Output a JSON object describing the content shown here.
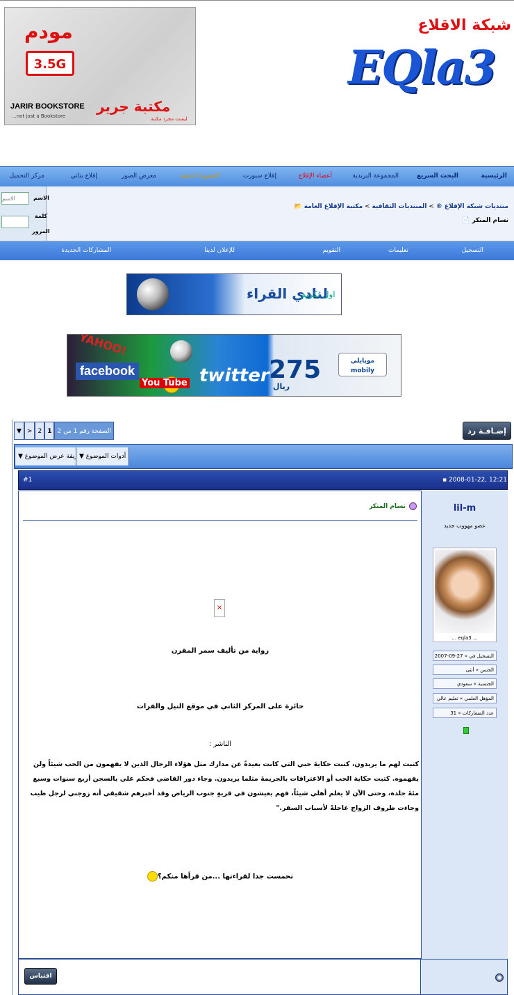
{
  "ads": {
    "jarir": {
      "modem": "مودم",
      "speed": "3.5G",
      "brand_en": "JARIR BOOKSTORE",
      "brand_ar": "مكتبة جرير",
      "tagline_en": "...not just a Bookstore",
      "tagline_ar": "ليست مجرد مكتبة"
    },
    "club_banner": {
      "text": "لنادي القراء",
      "subtext": "اول تكريم"
    },
    "mobily": {
      "yahoo": "YAHOO!",
      "facebook": "facebook",
      "youtube": "You Tube",
      "twitter": "twitter",
      "price": "275",
      "currency": "ريال",
      "brand": "موبايلي mobily"
    }
  },
  "logo": {
    "network": "شبكة الاقلاع",
    "name": "EQla3"
  },
  "nav_top": [
    "الرئيسية",
    "البحث السريع",
    "المجموعة البريدية",
    "أعضاء الإقلاع",
    "إقلاع سبورت",
    "العضوية الذهبية",
    "معرض الصور",
    "إقلاع بناتي",
    "مركز التحميل"
  ],
  "login": {
    "user_label": "الاسم",
    "user_placeholder": "الاسم",
    "pass_label1": "كلمة",
    "pass_label2": "المرور"
  },
  "breadcrumb": {
    "items": [
      "منتديات شبكة الإقلاع ®",
      "المنتديات الثقافية",
      "مكتبة الإقلاع العامة"
    ],
    "sep": ">",
    "thread_title": "نسام المنكر"
  },
  "nav_bottom": [
    "التسجيل",
    "تعليمات",
    "التقويم",
    "للإعلان لدينا",
    "المشاركات الجديدة"
  ],
  "thread": {
    "reply_button": "إضـافـة رد",
    "pager": {
      "label": "الصفحة رقم 1 من 2",
      "pages": [
        "1",
        "2"
      ],
      "next": ">",
      "menu": "▼"
    },
    "tools": {
      "thread_tools": "أدوات الموضوع",
      "display_mode": "طريقة عرض الموضوع"
    }
  },
  "post": {
    "date": "2008-01-22, 12:21 PM",
    "number": "#1",
    "title": "نسام المنكر",
    "author": {
      "username": "lil-m",
      "rank": "عضو مهووب جديد",
      "avatar_caption": "... eqla3 ...",
      "fields": [
        "التسجيل في » 27-09-2007",
        "الجنس » أنثى",
        "الجنسية » سعودي",
        "المؤهل العلمي » تعليم عالي",
        "عدد المشاركات » 31"
      ]
    },
    "line1": "رواية من تأليف سمر المقرن",
    "line2": "حائزة على المركز الثاني في موقع النيل والفرات",
    "line3": "الناشر :",
    "paragraph": "كتبت لهم ما يريدون، كتبت حكايةَ حبي التي كانت بعيدةً عن مدارك مثل هؤلاء الرجال الذين لا يفهمون من الحب شيئاً ولن يفهموه. كتبت حكاية الحب أو الاعترافات بالجريمةَ مثلما يريدون. وجاء دور القاضي فحكم علي بالسجن أربع سنوات وسبع مئةَ جلدة، وحتى الآن لا يعلم أهلي شيئاً، فهم يعيشون في قريةٍ جنوب الرياض وقد أخبرهم شقيقي أنه زوجني لرجل طيب وجاءت ظروف الزواج عاجلةً لأسباب السفر.\"",
    "closing": "تحمست جدا لقراءتها ...من قرأها منكم؟",
    "quote_button": "اقتباس"
  }
}
